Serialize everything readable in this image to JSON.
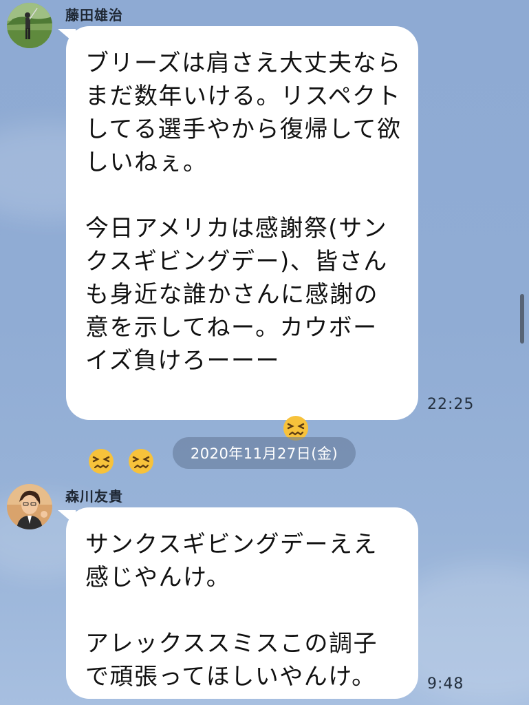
{
  "messages": [
    {
      "sender": "藤田雄治",
      "text_main": "ブリーズは肩さえ大丈夫ならまだ数年いける。リスペクトしてる選手やから復帰して欲しいねぇ。\n\n今日アメリカは感謝祭(サンクスギビングデー)、皆さんも身近な誰かさんに感謝の意を示してねー。カウボーイズ負けろーーー",
      "emoji": "persevering-face-emoji",
      "time": "22:25"
    },
    {
      "sender": "森川友貴",
      "text_main": "サンクスギビングデーええ感じやんけ。\n\nアレックススミスこの調子で頑張ってほしいやんけ。",
      "time": "9:48"
    }
  ],
  "date_separator": "2020年11月27日(金)",
  "colors": {
    "background": "#8eaad3",
    "bubble": "#ffffff",
    "date_pill": "#6c7f9c"
  }
}
